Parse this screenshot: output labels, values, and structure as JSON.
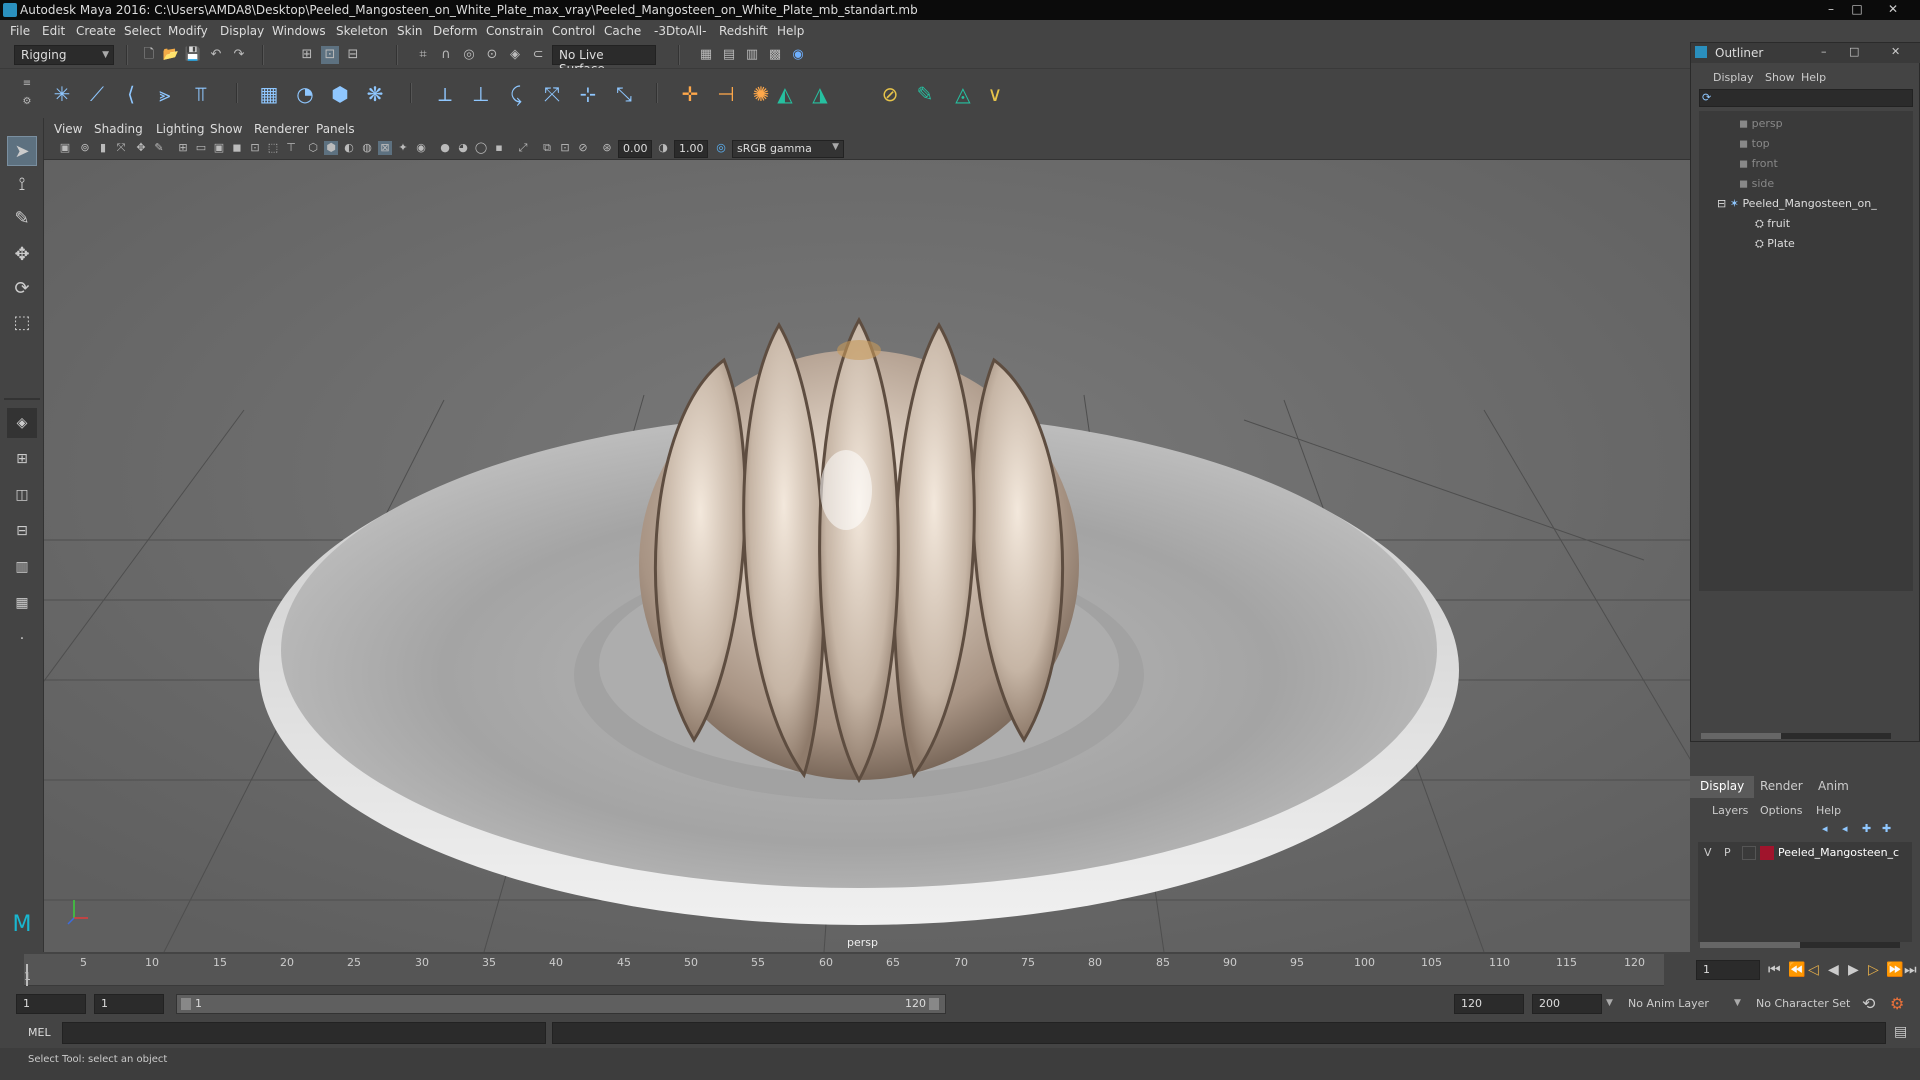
{
  "window": {
    "title": "Autodesk Maya 2016: C:\\Users\\AMDA8\\Desktop\\Peeled_Mangosteen_on_White_Plate_max_vray\\Peeled_Mangosteen_on_White_Plate_mb_standart.mb",
    "minimize": "–",
    "maximize": "□",
    "close": "✕"
  },
  "menu": [
    "File",
    "Edit",
    "Create",
    "Select",
    "Modify",
    "Display",
    "Windows",
    "Skeleton",
    "Skin",
    "Deform",
    "Constrain",
    "Control",
    "Cache",
    "-3DtoAll-",
    "Redshift",
    "Help"
  ],
  "toolbar": {
    "mode": "Rigging",
    "live_surface": "No Live Surface"
  },
  "viewport": {
    "menu": [
      "View",
      "Shading",
      "Lighting",
      "Show",
      "Renderer",
      "Panels"
    ],
    "exposure": "0.00",
    "gamma": "1.00",
    "color_space": "sRGB gamma",
    "camera": "persp"
  },
  "timeline": {
    "ticks": [
      "1",
      "5",
      "10",
      "15",
      "20",
      "25",
      "30",
      "35",
      "40",
      "45",
      "50",
      "55",
      "60",
      "65",
      "70",
      "75",
      "80",
      "85",
      "90",
      "95",
      "100",
      "105",
      "110",
      "115",
      "120"
    ],
    "current_frame": "1"
  },
  "range": {
    "start": "1",
    "playback_start": "1",
    "slider_start": "1",
    "slider_end": "120",
    "playback_end": "120",
    "end": "200",
    "anim_layer": "No Anim Layer",
    "character_set": "No Character Set"
  },
  "cmdline": {
    "lang": "MEL"
  },
  "helpline": {
    "text": "Select Tool: select an object"
  },
  "outliner": {
    "title": "Outliner",
    "menu": [
      "Display",
      "Show",
      "Help"
    ],
    "items": [
      {
        "label": "persp"
      },
      {
        "label": "top"
      },
      {
        "label": "front"
      },
      {
        "label": "side"
      },
      {
        "label": "Peeled_Mangosteen_on_"
      },
      {
        "label": "fruit"
      },
      {
        "label": "Plate"
      }
    ]
  },
  "channelbox": {
    "tabs": [
      "Display",
      "Render",
      "Anim"
    ],
    "menu": [
      "Layers",
      "Options",
      "Help"
    ],
    "layer": {
      "v": "V",
      "p": "P",
      "name": "Peeled_Mangosteen_c",
      "color": "#a0142c"
    }
  },
  "colors": {
    "accent": "#5d7180",
    "icon_blue": "#8fc7ff"
  }
}
